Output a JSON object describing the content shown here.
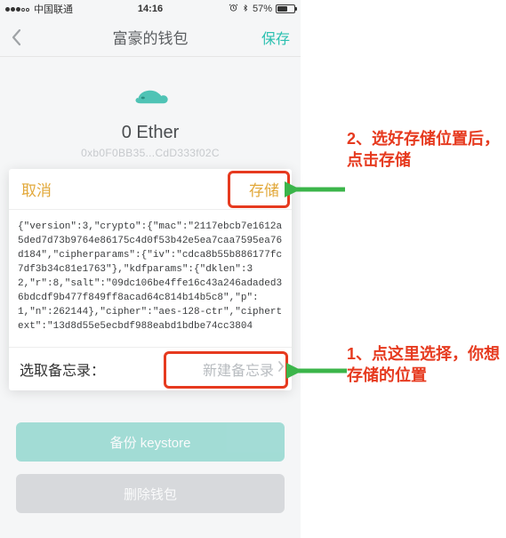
{
  "statusbar": {
    "carrier": "中国联通",
    "time": "14:16",
    "battery_pct": "57%"
  },
  "navbar": {
    "title": "富豪的钱包",
    "save": "保存"
  },
  "wallet": {
    "balance": "0 Ether",
    "address": "0xb0F0BB35...CdD333f02C"
  },
  "sheet": {
    "cancel": "取消",
    "store": "存储",
    "json_text": "{\"version\":3,\"crypto\":{\"mac\":\"2117ebcb7e1612a5ded7d73b9764e86175c4d0f53b42e5ea7caa7595ea76d184\",\"cipherparams\":{\"iv\":\"cdca8b55b886177fc7df3b34c81e1763\"},\"kdfparams\":{\"dklen\":32,\"r\":8,\"salt\":\"09dc106be4ffe16c43a246adaded36bdcdf9b477f849ff8acad64c814b14b5c8\",\"p\":1,\"n\":262144},\"cipher\":\"aes-128-ctr\",\"ciphertext\":\"13d8d55e5ecbdf988eabd1bdbe74cc3804",
    "row_label": "选取备忘录：",
    "row_value": "新建备忘录"
  },
  "buttons": {
    "backup": "备份 keystore",
    "delete": "删除钱包"
  },
  "annotations": {
    "a2": "2、选好存储位置后，点击存储",
    "a1": "1、点这里选择，你想存储的位置"
  }
}
